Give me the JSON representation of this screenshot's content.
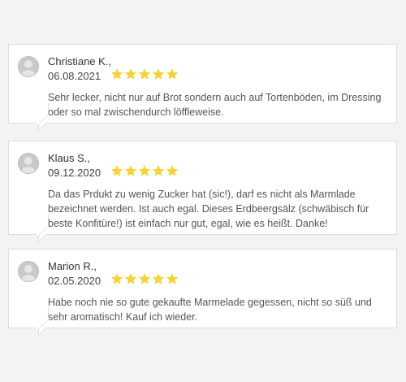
{
  "reviews": [
    {
      "author": "Christiane K.,",
      "date": "06.08.2021",
      "rating": 5,
      "text": "Sehr lecker, nicht nur auf Brot sondern auch auf Tortenböden, im Dressing oder so mal zwischendurch löffleweise."
    },
    {
      "author": "Klaus S.,",
      "date": "09.12.2020",
      "rating": 5,
      "text": "Da das Prdukt zu wenig Zucker hat (sic!), darf es nicht als Marmlade bezeichnet werden. Ist auch egal. Dieses Erdbeergsälz (schwäbisch für beste Konfitüre!) ist einfach nur gut, egal, wie es heißt. Danke!"
    },
    {
      "author": "Marion R.,",
      "date": "02.05.2020",
      "rating": 5,
      "text": "Habe noch nie so gute gekaufte Marmelade gegessen, nicht so süß und sehr aromatisch! Kauf ich wieder."
    }
  ],
  "colors": {
    "star": "#f5d335",
    "background": "#f4f3f1",
    "card": "#ffffff",
    "border": "#dcdcdc"
  }
}
